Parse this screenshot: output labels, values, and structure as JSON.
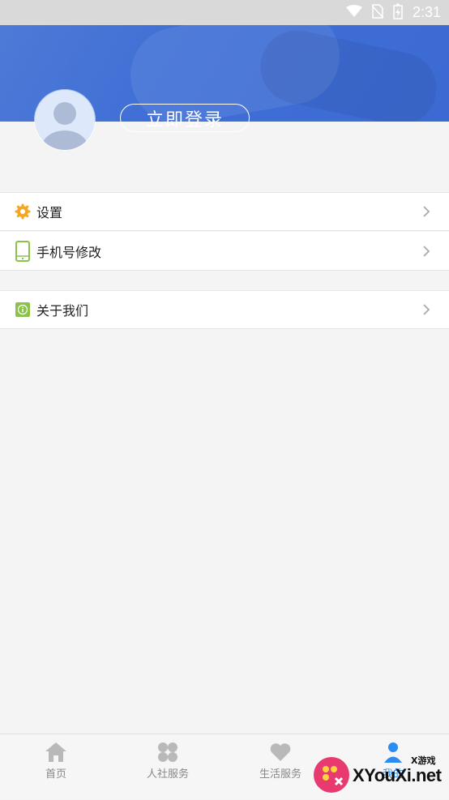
{
  "status_bar": {
    "time": "2:31",
    "icons": [
      "wifi-icon",
      "no-sim-icon",
      "battery-charging-icon"
    ]
  },
  "profile": {
    "login_label": "立即登录",
    "avatar_icon": "default-avatar-icon"
  },
  "menu": {
    "items": [
      {
        "label": "设置",
        "icon": "settings-gear-icon",
        "icon_color": "#f5a623"
      },
      {
        "label": "手机号修改",
        "icon": "phone-icon",
        "icon_color": "#8bc34a"
      },
      {
        "label": "关于我们",
        "icon": "info-icon",
        "icon_color": "#8bc34a"
      }
    ]
  },
  "tabs": [
    {
      "label": "首页",
      "icon": "home-icon"
    },
    {
      "label": "人社服务",
      "icon": "clover-icon"
    },
    {
      "label": "生活服务",
      "icon": "heart-icon"
    },
    {
      "label": "我的",
      "icon": "person-icon",
      "active": true
    }
  ],
  "colors": {
    "header_blue": "#3f6fd6",
    "accent_blue": "#2d8cf0",
    "background": "#f4f4f4"
  },
  "watermark": {
    "main": "XYouXi.net",
    "sub": "X游戏"
  }
}
